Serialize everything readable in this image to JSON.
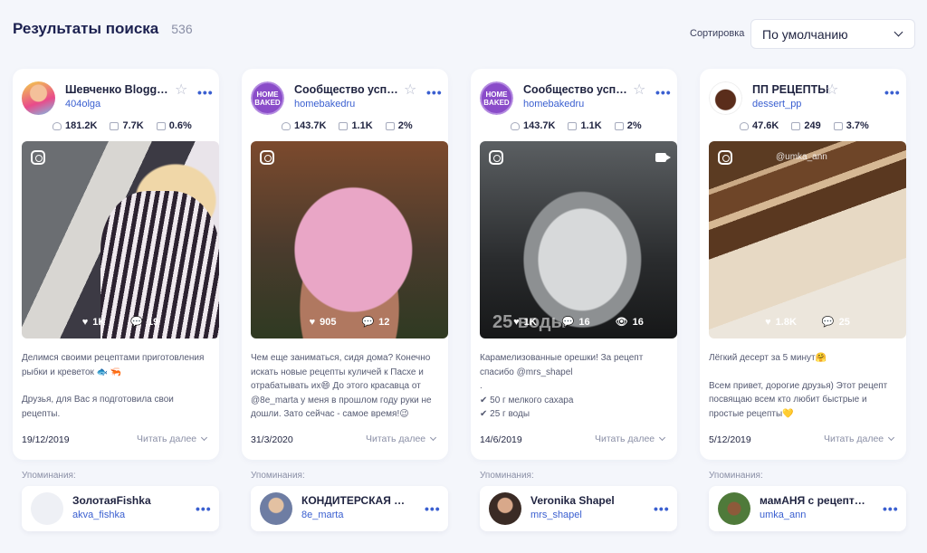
{
  "header": {
    "title": "Результаты поиска",
    "count": "536"
  },
  "sort": {
    "label": "Сортировка",
    "value": "По умолчанию"
  },
  "mentions_label": "Упоминания:",
  "read_more": "Читать далее",
  "cards": [
    {
      "name": "Шевченко Blogge...",
      "handle": "404olga",
      "followers": "181.2K",
      "posts": "7.7K",
      "er": "0.6%",
      "likes": "1K",
      "comments": "19",
      "desc": [
        "Делимся своими рецептами приготовления рыбки и креветок 🐟 🦐",
        "",
        "Друзья, для Вас я подготовила свои рецепты."
      ],
      "date": "19/12/2019",
      "mention": {
        "name": "ЗолотаяFishka",
        "handle": "akva_fishka"
      }
    },
    {
      "name": "Сообщество успе...",
      "handle": "homebakedru",
      "followers": "143.7K",
      "posts": "1.1K",
      "er": "2%",
      "likes": "905",
      "comments": "12",
      "desc": [
        "Чем еще заниматься, сидя дома? Конечно искать новые рецепты куличей к Пасхе и отрабатывать их😄 До этого красавца от @8e_marta у меня в прошлом году руки не дошли. Зато сейчас - самое время!😉"
      ],
      "date": "31/3/2020",
      "mention": {
        "name": "КОНДИТЕРСКАЯ ХИ...",
        "handle": "8e_marta"
      }
    },
    {
      "name": "Сообщество успе...",
      "handle": "homebakedru",
      "followers": "143.7K",
      "posts": "1.1K",
      "er": "2%",
      "likes": "1K",
      "comments": "16",
      "views": "16",
      "desc": [
        "Карамелизованные орешки! За рецепт спасибо @mrs_shapel",
        ".",
        "✔ 50 г мелкого сахара",
        "✔ 25 г воды"
      ],
      "date": "14/6/2019",
      "mention": {
        "name": "Veronika Shapel",
        "handle": "mrs_shapel"
      }
    },
    {
      "name": "ПП РЕЦЕПТЫ",
      "handle": "dessert_pp",
      "followers": "47.6K",
      "posts": "249",
      "er": "3.7%",
      "likes": "1.8K",
      "comments": "25",
      "desc": [
        "Лёгкий десерт за 5 минут🤗",
        "",
        "Всем привет, дорогие друзья) Этот рецепт посвящаю всем кто любит быстрые и простые рецепты💛"
      ],
      "date": "5/12/2019",
      "mention": {
        "name": "мамАНЯ с рецепта...",
        "handle": "umka_ann"
      }
    }
  ],
  "media_overlay": {
    "c3_text": "25 воды",
    "c4_watermark": "@umka_ann"
  },
  "avatar_text": {
    "hb_line1": "HOME",
    "hb_line2": "BAKED"
  }
}
